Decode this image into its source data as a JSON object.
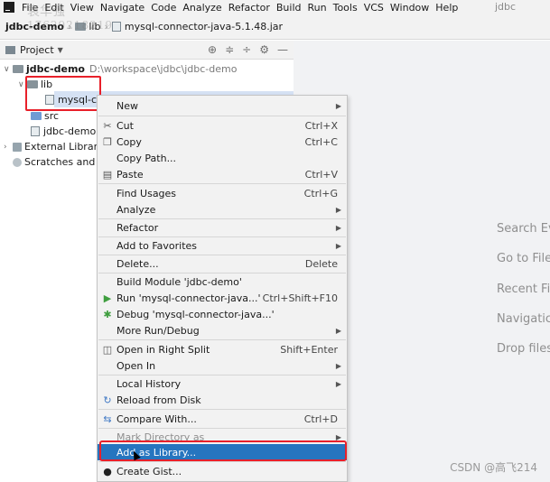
{
  "menubar": {
    "items": [
      "File",
      "Edit",
      "View",
      "Navigate",
      "Code",
      "Analyze",
      "Refactor",
      "Build",
      "Run",
      "Tools",
      "VCS",
      "Window",
      "Help"
    ],
    "project_name": "jdbc"
  },
  "breadcrumb": {
    "project": "jdbc-demo",
    "folder": "lib",
    "file": "mysql-connector-java-5.1.48.jar"
  },
  "watermark": {
    "name": "袁华强",
    "number": "17629218219"
  },
  "project_panel": {
    "title": "Project"
  },
  "tree": {
    "root_label": "jdbc-demo",
    "root_path": "D:\\workspace\\jdbc\\jdbc-demo",
    "lib_label": "lib",
    "jar_label": "mysql-cc",
    "src_label": "src",
    "iml_label": "jdbc-demo.",
    "ext_label": "External Librari",
    "scratch_label": "Scratches and C"
  },
  "context_menu": {
    "new": "New",
    "cut": "Cut",
    "cut_sc": "Ctrl+X",
    "copy": "Copy",
    "copy_sc": "Ctrl+C",
    "copy_path": "Copy Path...",
    "paste": "Paste",
    "paste_sc": "Ctrl+V",
    "find_usages": "Find Usages",
    "find_usages_sc": "Ctrl+G",
    "analyze": "Analyze",
    "refactor": "Refactor",
    "add_to_favorites": "Add to Favorites",
    "delete": "Delete...",
    "delete_sc": "Delete",
    "build_module": "Build Module 'jdbc-demo'",
    "run": "Run 'mysql-connector-java...'",
    "run_sc": "Ctrl+Shift+F10",
    "debug": "Debug 'mysql-connector-java...'",
    "more_run": "More Run/Debug",
    "open_right_split": "Open in Right Split",
    "open_right_split_sc": "Shift+Enter",
    "open_in": "Open In",
    "local_history": "Local History",
    "reload_disk": "Reload from Disk",
    "compare_with": "Compare With...",
    "compare_with_sc": "Ctrl+D",
    "mark_directory": "Mark Directory as",
    "add_as_library": "Add as Library...",
    "create_gist": "Create Gist..."
  },
  "editor_hints": [
    "Search Ev",
    "Go to File",
    "Recent Fi",
    "Navigatic",
    "Drop files"
  ],
  "csdn": "CSDN @高飞214"
}
